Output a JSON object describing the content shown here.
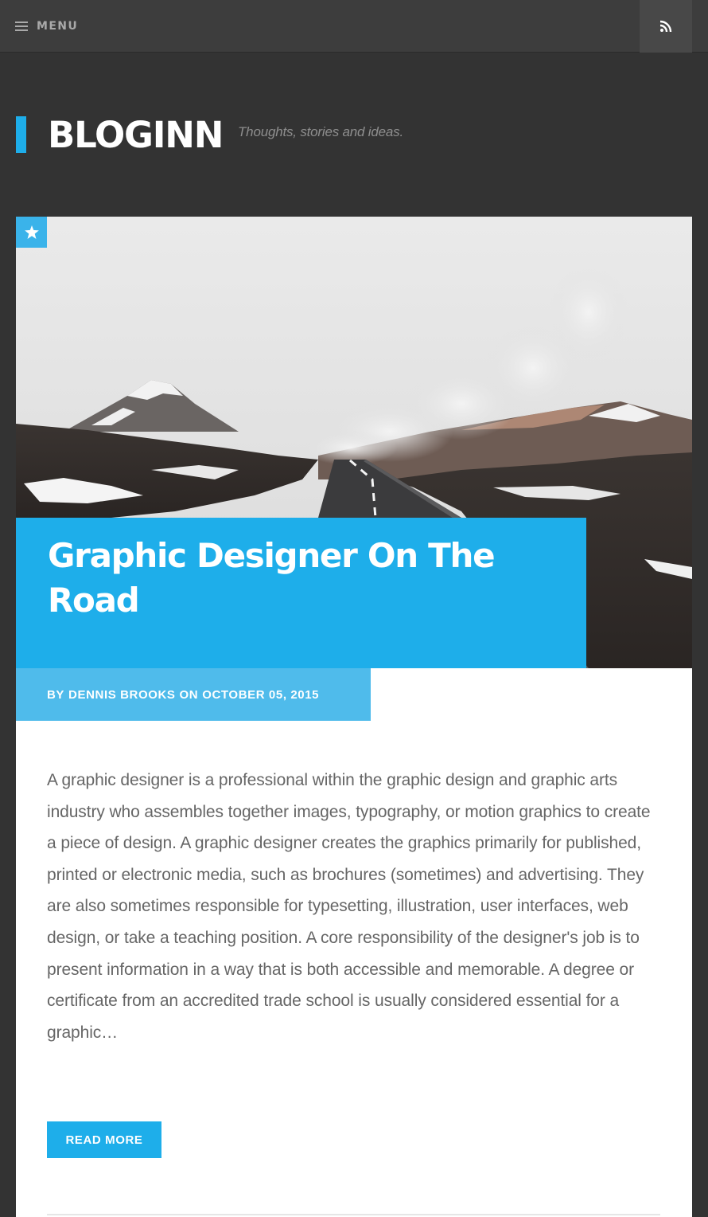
{
  "topbar": {
    "menu_label": "MENU",
    "menu_icon": "hamburger-icon",
    "rss_icon": "rss-icon"
  },
  "header": {
    "site_title": "BLOGINN",
    "tagline": "Thoughts, stories and ideas."
  },
  "post": {
    "sticky_icon": "star-icon",
    "title": "Graphic Designer On The Road",
    "meta": {
      "by": "BY",
      "author": "DENNIS BROOKS",
      "on": "ON",
      "date": "OCTOBER 05, 2015"
    },
    "excerpt": "A graphic designer is a professional within the graphic design and graphic arts industry who assembles together images, typography, or motion graphics to create a piece of design. A graphic designer creates the graphics primarily for published, printed or electronic media, such as brochures (sometimes) and advertising. They are also sometimes responsible for typesetting, illustration, user interfaces, web design, or take a teaching position. A core responsibility of the designer's job is to present information in a way that is both accessible and memorable. A degree or certificate from an accredited trade school is usually considered essential for a graphic…",
    "read_more_label": "READ MORE"
  },
  "colors": {
    "accent": "#1eaeea",
    "meta_bar": "#4fbbeb",
    "background": "#333333",
    "topbar": "#3d3d3d"
  }
}
